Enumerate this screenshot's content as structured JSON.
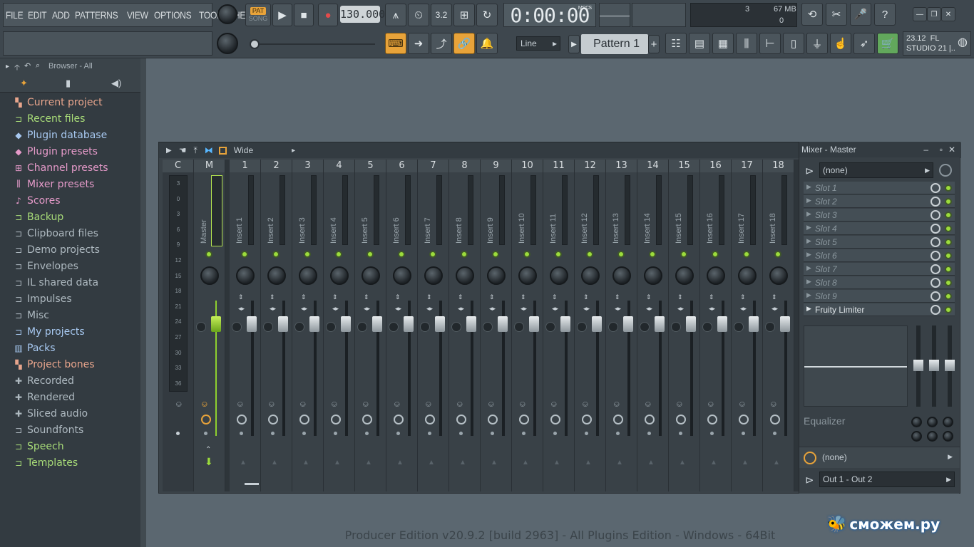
{
  "menu": [
    "FILE",
    "EDIT",
    "ADD",
    "PATTERNS",
    "VIEW",
    "OPTIONS",
    "TOOLS",
    "HELP"
  ],
  "transport": {
    "pat_label": "PAT",
    "song_label": "SONG",
    "tempo": "130.000",
    "time": "0:00:00",
    "time_unit": "M:S:CS"
  },
  "monitor": {
    "cpu": "3",
    "mem": "67 MB",
    "poly": "0"
  },
  "toolbar2": {
    "snap": "Line",
    "pattern": "Pattern 1"
  },
  "news": {
    "version": "23.12",
    "brand": "FL",
    "studio": "STUDIO 21 |.."
  },
  "browser": {
    "title": "Browser - All",
    "items": [
      {
        "label": "Current project",
        "color": "#e8a58c",
        "icon": "project-icon"
      },
      {
        "label": "Recent files",
        "color": "#a8dc78",
        "icon": "folder-recent-icon"
      },
      {
        "label": "Plugin database",
        "color": "#a7c8f0",
        "icon": "plug-icon"
      },
      {
        "label": "Plugin presets",
        "color": "#e59ac9",
        "icon": "plug-icon"
      },
      {
        "label": "Channel presets",
        "color": "#e59ac9",
        "icon": "channel-icon"
      },
      {
        "label": "Mixer presets",
        "color": "#e59ac9",
        "icon": "mixer-icon"
      },
      {
        "label": "Scores",
        "color": "#e59ac9",
        "icon": "note-icon"
      },
      {
        "label": "Backup",
        "color": "#a8dc78",
        "icon": "folder-icon"
      },
      {
        "label": "Clipboard files",
        "color": "#aeb9c0",
        "icon": "folder-icon"
      },
      {
        "label": "Demo projects",
        "color": "#aeb9c0",
        "icon": "folder-icon"
      },
      {
        "label": "Envelopes",
        "color": "#aeb9c0",
        "icon": "folder-icon"
      },
      {
        "label": "IL shared data",
        "color": "#aeb9c0",
        "icon": "folder-icon"
      },
      {
        "label": "Impulses",
        "color": "#aeb9c0",
        "icon": "folder-icon"
      },
      {
        "label": "Misc",
        "color": "#aeb9c0",
        "icon": "folder-icon"
      },
      {
        "label": "My projects",
        "color": "#a7c8f0",
        "icon": "folder-icon"
      },
      {
        "label": "Packs",
        "color": "#a7c8f0",
        "icon": "packs-icon"
      },
      {
        "label": "Project bones",
        "color": "#e8a58c",
        "icon": "project-icon"
      },
      {
        "label": "Recorded",
        "color": "#aeb9c0",
        "icon": "record-icon"
      },
      {
        "label": "Rendered",
        "color": "#aeb9c0",
        "icon": "record-icon"
      },
      {
        "label": "Sliced audio",
        "color": "#aeb9c0",
        "icon": "record-icon"
      },
      {
        "label": "Soundfonts",
        "color": "#aeb9c0",
        "icon": "folder-icon"
      },
      {
        "label": "Speech",
        "color": "#a8dc78",
        "icon": "folder-icon"
      },
      {
        "label": "Templates",
        "color": "#a8dc78",
        "icon": "folder-icon"
      }
    ]
  },
  "mixer": {
    "mode": "Wide",
    "title": "Mixer - Master",
    "current_label": "C",
    "master_label": "M",
    "master_name": "Master",
    "meter_scale": [
      "3",
      "0",
      "3",
      "6",
      "9",
      "12",
      "15",
      "18",
      "21",
      "24",
      "27",
      "30",
      "33",
      "36"
    ],
    "inserts": [
      {
        "num": "1",
        "name": "Insert 1"
      },
      {
        "num": "2",
        "name": "Insert 2"
      },
      {
        "num": "3",
        "name": "Insert 3"
      },
      {
        "num": "4",
        "name": "Insert 4"
      },
      {
        "num": "5",
        "name": "Insert 5"
      },
      {
        "num": "6",
        "name": "Insert 6"
      },
      {
        "num": "7",
        "name": "Insert 7"
      },
      {
        "num": "8",
        "name": "Insert 8"
      },
      {
        "num": "9",
        "name": "Insert 9"
      },
      {
        "num": "10",
        "name": "Insert 10"
      },
      {
        "num": "11",
        "name": "Insert 11"
      },
      {
        "num": "12",
        "name": "Insert 12"
      },
      {
        "num": "13",
        "name": "Insert 13"
      },
      {
        "num": "14",
        "name": "Insert 14"
      },
      {
        "num": "15",
        "name": "Insert 15"
      },
      {
        "num": "16",
        "name": "Insert 16"
      },
      {
        "num": "17",
        "name": "Insert 17"
      },
      {
        "num": "18",
        "name": "Insert 18"
      }
    ],
    "input": "(none)",
    "slots": [
      "Slot 1",
      "Slot 2",
      "Slot 3",
      "Slot 4",
      "Slot 5",
      "Slot 6",
      "Slot 7",
      "Slot 8",
      "Slot 9",
      "Fruity Limiter"
    ],
    "eq_label": "Equalizer",
    "output_none": "(none)",
    "output": "Out 1 - Out 2"
  },
  "statusbar": "Producer Edition v20.9.2 [build 2963] - All Plugins Edition - Windows - 64Bit",
  "watermark": "сможем.ру"
}
